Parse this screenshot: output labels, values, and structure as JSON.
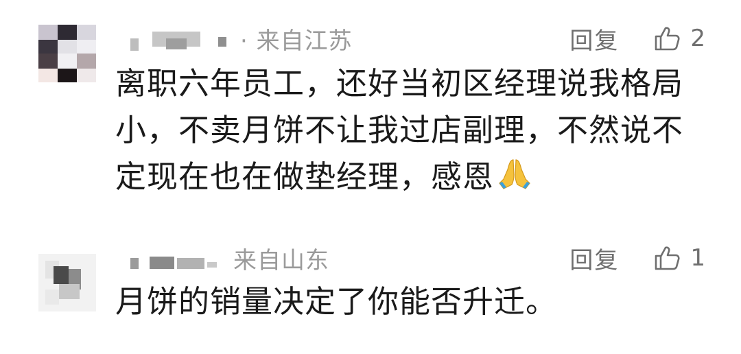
{
  "comments": [
    {
      "location": "· 来自江苏",
      "reply_label": "回复",
      "like_count": "2",
      "text": "离职六年员工，还好当初区经理说我格局小，不卖月饼不让我过店副理，不然说不定现在也在做垫经理，感恩",
      "emoji_icon": "folded-hands-icon"
    },
    {
      "location": "来自山东",
      "reply_label": "回复",
      "like_count": "1",
      "text": "月饼的销量决定了你能否升迁。"
    }
  ],
  "colors": {
    "text": "#1a1a1a",
    "meta": "#9a9a9a",
    "action": "#6f6f6f"
  }
}
